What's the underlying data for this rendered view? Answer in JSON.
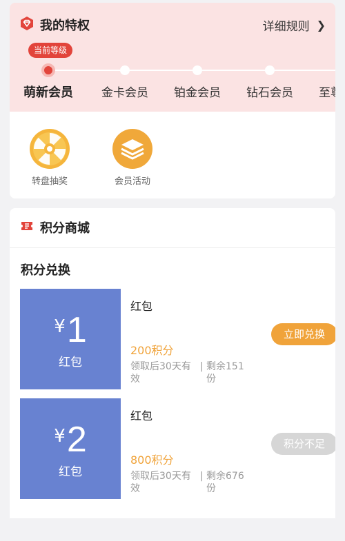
{
  "privileges": {
    "title": "我的特权",
    "rules_label": "详细规则",
    "rules_chevron": "❯",
    "current_badge": "当前等级",
    "levels": [
      "萌新会员",
      "金卡会员",
      "铂金会员",
      "钻石会员",
      "至尊会员"
    ],
    "current_level_index": 0,
    "perks": [
      {
        "label": "转盘抽奖",
        "icon": "lucky-wheel-icon"
      },
      {
        "label": "会员活动",
        "icon": "activity-stack-icon"
      }
    ]
  },
  "mall": {
    "title": "积分商城",
    "section_title": "积分兑换",
    "coupons": [
      {
        "currency": "¥",
        "amount": "1",
        "type_label": "红包",
        "name": "红包",
        "points": "200积分",
        "validity": "领取后30天有效",
        "separator": "|",
        "remaining": "剩余151份",
        "button": "立即兑换",
        "enabled": true
      },
      {
        "currency": "¥",
        "amount": "2",
        "type_label": "红包",
        "name": "红包",
        "points": "800积分",
        "validity": "领取后30天有效",
        "separator": "|",
        "remaining": "剩余676份",
        "button": "积分不足",
        "enabled": false
      }
    ]
  },
  "colors": {
    "accent_red": "#e2443b",
    "coupon_blue": "#6882d1",
    "points_orange": "#f0a33a",
    "header_pink": "#fbe3e3"
  }
}
